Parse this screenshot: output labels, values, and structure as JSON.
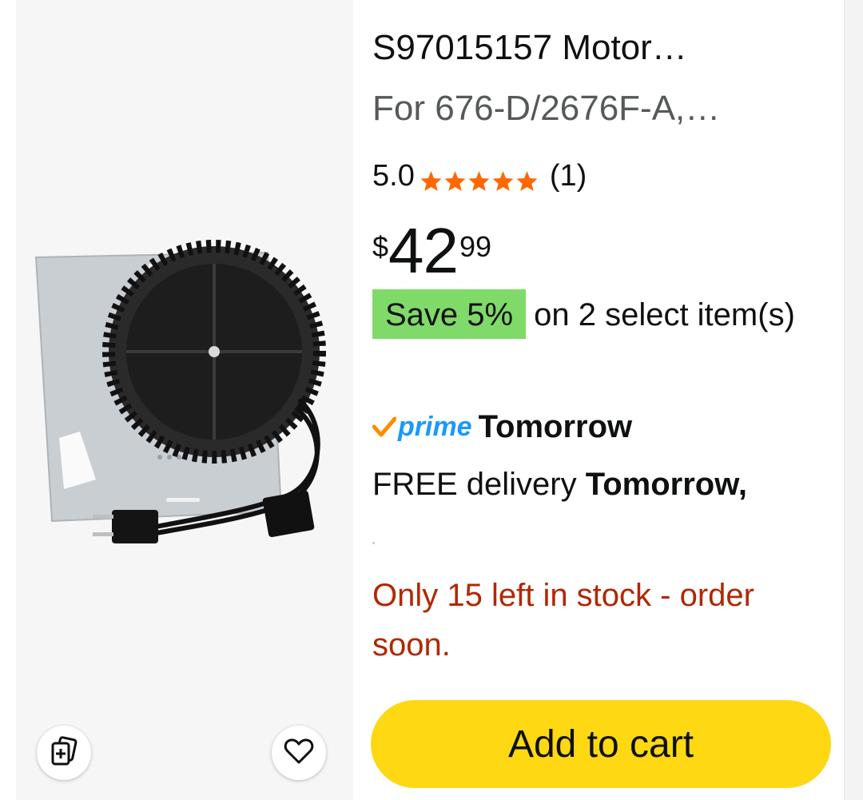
{
  "product": {
    "title": "S97015157 Motor…",
    "subtitle": "For 676-D/2676F-A,…",
    "rating_value": "5.0",
    "rating_stars": 5,
    "rating_count": "(1)",
    "price": {
      "symbol": "$",
      "whole": "42",
      "fraction": "99"
    },
    "save_badge": "Save 5%",
    "save_text": "on 2 select item(s)",
    "prime_label": "prime",
    "prime_day": "Tomorrow",
    "delivery_prefix": "FREE delivery",
    "delivery_day": "Tomorrow,",
    "stock_message": "Only 15 left in stock - order soon."
  },
  "actions": {
    "add_to_cart": "Add to cart"
  },
  "icons": {
    "compare": "compare-cards-icon",
    "wishlist": "heart-icon",
    "star": "star-icon",
    "prime_check": "prime-check-icon"
  },
  "colors": {
    "star": "#ff6700",
    "save_badge": "#7fda69",
    "prime": "#1a98ff",
    "stock": "#b12704",
    "cart_button": "#ffd814"
  }
}
